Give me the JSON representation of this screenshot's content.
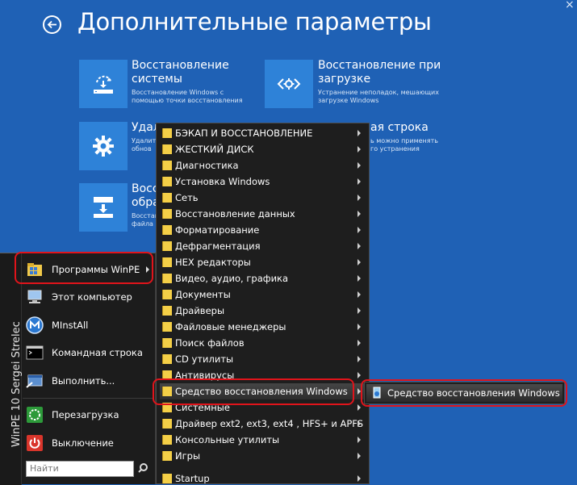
{
  "header": {
    "title": "Дополнительные параметры"
  },
  "tiles": [
    {
      "title": "Восстановление системы",
      "title_line1": "Восстановление",
      "title_line2": "системы",
      "desc_line1": "Восстановление Windows с",
      "desc_line2": "помощью точки восстановления",
      "icon": "restore-icon"
    },
    {
      "title": "Восстановление при загрузке",
      "title_line1": "Восстановление при",
      "title_line2": "загрузке",
      "desc_line1": "Устранение неполадок, мешающих",
      "desc_line2": "загрузке Windows",
      "icon": "code-icon"
    },
    {
      "title_line1": "Удал",
      "title_line2": "",
      "desc_line1": "Удалит",
      "desc_line2": "обнов",
      "icon": "gear-icon"
    },
    {
      "title_line1": "ая строка",
      "title_line2": "",
      "desc_line1": "ь можно применять",
      "desc_line2": "го устранения",
      "icon": "cmd-icon"
    },
    {
      "title_line1": "Восс",
      "title_line2": "обра",
      "desc_line1": "Восстан",
      "desc_line2": "файла",
      "icon": "image-restore-icon"
    }
  ],
  "start_menu": {
    "brand": "WinPE 10 Sergei Strelec",
    "items": [
      {
        "label": "Программы WinPE",
        "icon": "programs-icon"
      },
      {
        "label": "Этот компьютер",
        "icon": "computer-icon"
      },
      {
        "label": "MInstAll",
        "icon": "minstall-icon"
      },
      {
        "label": "Командная строка",
        "icon": "cmd-icon"
      },
      {
        "label": "Выполнить...",
        "icon": "run-icon"
      },
      {
        "label": "Перезагрузка",
        "icon": "restart-icon"
      },
      {
        "label": "Выключение",
        "icon": "power-icon"
      }
    ],
    "search_placeholder": "Найти"
  },
  "submenu": {
    "items": [
      "БЭКАП И ВОССТАНОВЛЕНИЕ",
      "ЖЕСТКИЙ ДИСК",
      "Диагностика",
      "Установка Windows",
      "Сеть",
      "Восстановление данных",
      "Форматирование",
      "Дефрагментация",
      "HEX редакторы",
      "Видео, аудио, графика",
      "Документы",
      "Драйверы",
      "Файловые менеджеры",
      "Поиск файлов",
      "CD утилиты",
      "Антивирусы",
      "Средство восстановления Windows",
      "Системные",
      "Драйвер ext2, ext3, ext4 , HFS+ и APFS",
      "Консольные утилиты",
      "Игры",
      "Startup"
    ],
    "highlighted_index": 16
  },
  "third_menu": {
    "label": "Средство восстановления Windows"
  },
  "colors": {
    "background": "#1f61b5",
    "tile": "#2e82d8",
    "highlight_outline": "#e0141b",
    "folder": "#f4cf47"
  }
}
